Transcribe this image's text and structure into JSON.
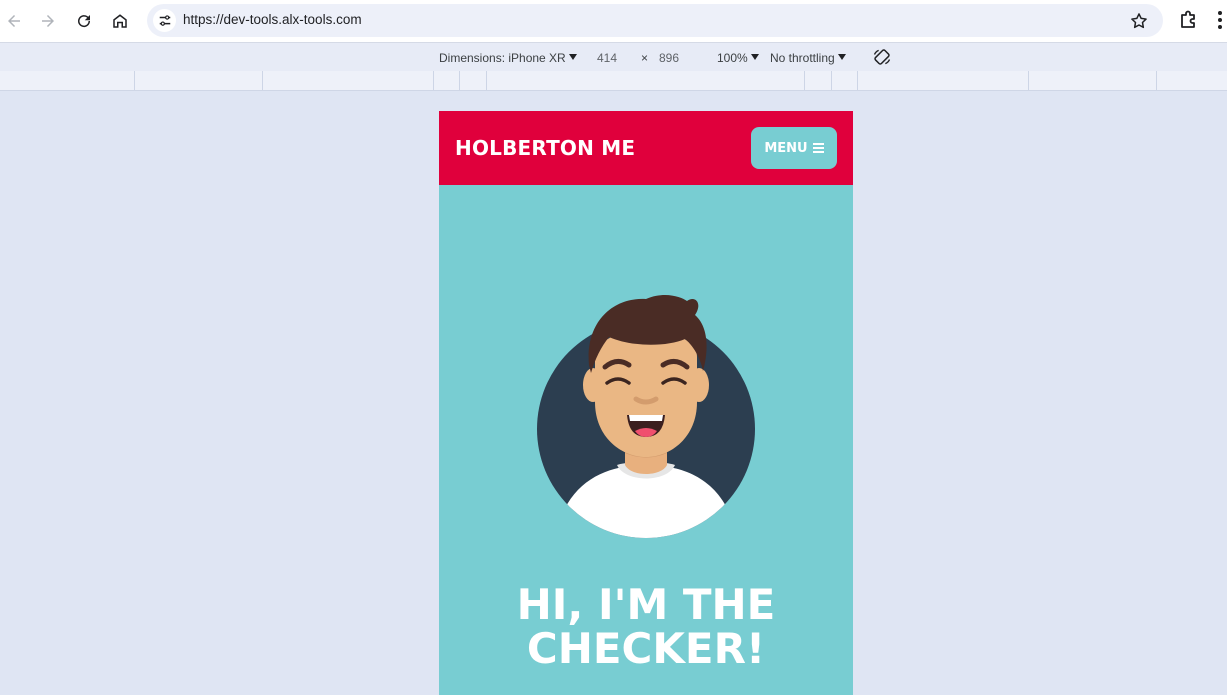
{
  "browser": {
    "url": "https://dev-tools.alx-tools.com",
    "nav_icons": [
      "back-arrow-icon",
      "forward-arrow-icon",
      "reload-icon",
      "home-icon"
    ],
    "site_info_icon": "tune-icon",
    "bookmark_icon": "star-icon",
    "extensions_icon": "puzzle-icon"
  },
  "devtools": {
    "dimensions_label": "Dimensions: iPhone XR",
    "width": "414",
    "times": "×",
    "height": "896",
    "zoom": "100%",
    "throttling": "No throttling",
    "rotate_icon": "rotate-icon"
  },
  "site": {
    "brand": "HOLBERTON ME",
    "menu_label": "MENU",
    "menu_icon": "hamburger-icon",
    "headline": "HI, I'M THE CHECKER!",
    "colors": {
      "header": "#e0003c",
      "accent": "#78cdd2",
      "avatar_circle": "#2c3e50"
    }
  }
}
